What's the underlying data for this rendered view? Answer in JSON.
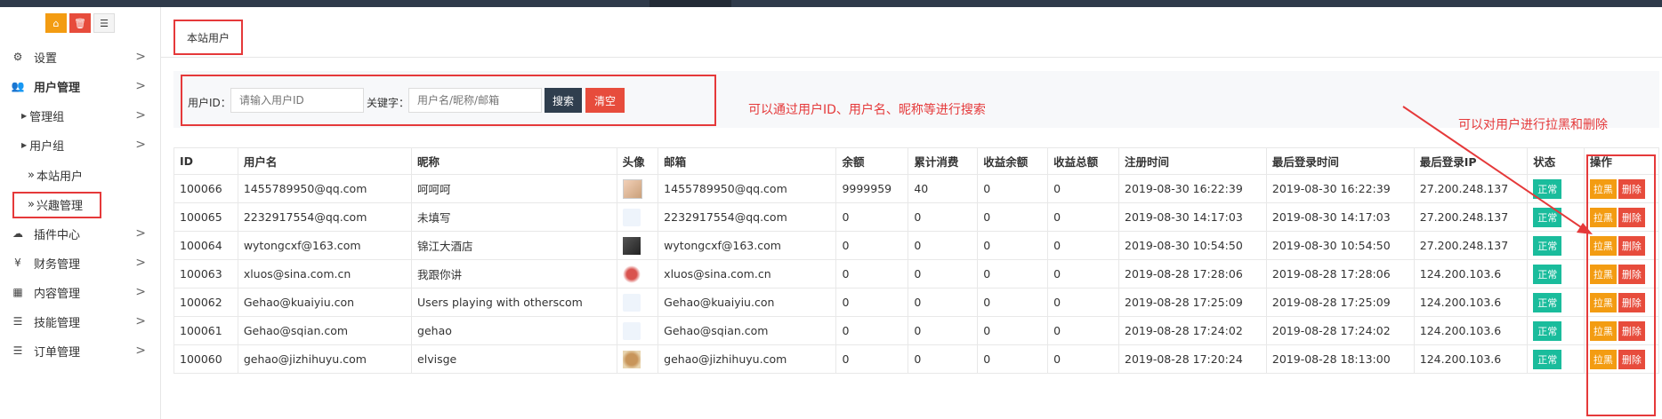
{
  "sidebar": {
    "top_icons": [
      "home-icon",
      "trash-icon",
      "list-icon"
    ],
    "items": [
      {
        "label": "设置",
        "icon": "gears-icon"
      },
      {
        "label": "用户管理",
        "icon": "users-icon"
      },
      {
        "label": "管理组"
      },
      {
        "label": "用户组"
      },
      {
        "label": "本站用户"
      },
      {
        "label": "兴趣管理"
      },
      {
        "label": "插件中心",
        "icon": "cloud-icon"
      },
      {
        "label": "财务管理",
        "icon": "yen-icon"
      },
      {
        "label": "内容管理",
        "icon": "grid-icon"
      },
      {
        "label": "技能管理",
        "icon": "bars-icon"
      },
      {
        "label": "订单管理",
        "icon": "bars-icon"
      }
    ],
    "chevron": ">",
    "raquo": "»"
  },
  "tab": {
    "label": "本站用户"
  },
  "search": {
    "id_label": "用户ID：",
    "id_placeholder": "请输入用户ID",
    "kw_label": "关键字：",
    "kw_placeholder": "用户名/昵称/邮箱",
    "search_button": "搜索",
    "clear_button": "清空"
  },
  "annotations": {
    "search_note": "可以通过用户ID、用户名、昵称等进行搜索",
    "ops_note": "可以对用户进行拉黑和删除"
  },
  "table": {
    "headers": [
      "ID",
      "用户名",
      "昵称",
      "头像",
      "邮箱",
      "余额",
      "累计消费",
      "收益余额",
      "收益总额",
      "注册时间",
      "最后登录时间",
      "最后登录IP",
      "状态",
      "操作"
    ],
    "status_label": "正常",
    "black_label": "拉黑",
    "delete_label": "删除",
    "rows": [
      {
        "id": "100066",
        "username": "1455789950@qq.com",
        "nickname": "呵呵呵",
        "avatar": "photo-person",
        "email": "1455789950@qq.com",
        "balance": "9999959",
        "spend": "40",
        "earn_balance": "0",
        "earn_total": "0",
        "reg_time": "2019-08-30 16:22:39",
        "last_login": "2019-08-30 16:22:39",
        "ip": "27.200.248.137"
      },
      {
        "id": "100065",
        "username": "2232917554@qq.com",
        "nickname": "未填写",
        "avatar": "default-avatar",
        "email": "2232917554@qq.com",
        "balance": "0",
        "spend": "0",
        "earn_balance": "0",
        "earn_total": "0",
        "reg_time": "2019-08-30 14:17:03",
        "last_login": "2019-08-30 14:17:03",
        "ip": "27.200.248.137"
      },
      {
        "id": "100064",
        "username": "wytongcxf@163.com",
        "nickname": "锦江大酒店",
        "avatar": "photo-dark",
        "email": "wytongcxf@163.com",
        "balance": "0",
        "spend": "0",
        "earn_balance": "0",
        "earn_total": "0",
        "reg_time": "2019-08-30 10:54:50",
        "last_login": "2019-08-30 10:54:50",
        "ip": "27.200.248.137"
      },
      {
        "id": "100063",
        "username": "xluos@sina.com.cn",
        "nickname": "我跟你讲",
        "avatar": "photo-food",
        "email": "xluos@sina.com.cn",
        "balance": "0",
        "spend": "0",
        "earn_balance": "0",
        "earn_total": "0",
        "reg_time": "2019-08-28 17:28:06",
        "last_login": "2019-08-28 17:28:06",
        "ip": "124.200.103.6"
      },
      {
        "id": "100062",
        "username": "Gehao@kuaiyiu.con",
        "nickname": "Users playing with otherscom",
        "avatar": "default-avatar",
        "email": "Gehao@kuaiyiu.con",
        "balance": "0",
        "spend": "0",
        "earn_balance": "0",
        "earn_total": "0",
        "reg_time": "2019-08-28 17:25:09",
        "last_login": "2019-08-28 17:25:09",
        "ip": "124.200.103.6"
      },
      {
        "id": "100061",
        "username": "Gehao@sqian.com",
        "nickname": "gehao",
        "avatar": "default-avatar",
        "email": "Gehao@sqian.com",
        "balance": "0",
        "spend": "0",
        "earn_balance": "0",
        "earn_total": "0",
        "reg_time": "2019-08-28 17:24:02",
        "last_login": "2019-08-28 17:24:02",
        "ip": "124.200.103.6"
      },
      {
        "id": "100060",
        "username": "gehao@jizhihuyu.com",
        "nickname": "elvisge",
        "avatar": "photo-dog",
        "email": "gehao@jizhihuyu.com",
        "balance": "0",
        "spend": "0",
        "earn_balance": "0",
        "earn_total": "0",
        "reg_time": "2019-08-28 17:20:24",
        "last_login": "2019-08-28 18:13:00",
        "ip": "124.200.103.6"
      }
    ]
  },
  "colors": {
    "accent_red": "#e5393a",
    "status_green": "#1abc9c",
    "orange": "#f39c12",
    "dark": "#2f3e4e"
  }
}
